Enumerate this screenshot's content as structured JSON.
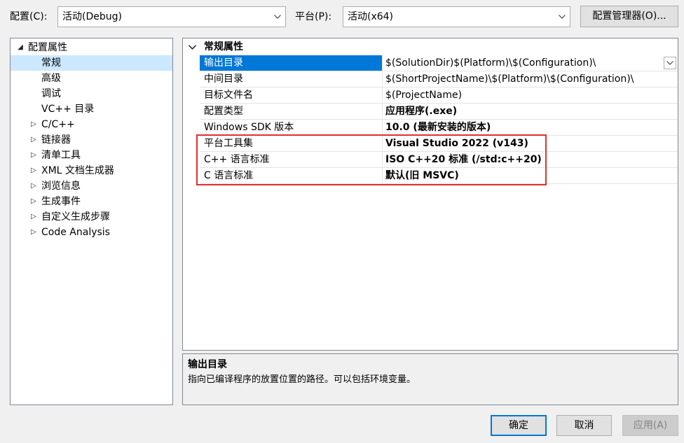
{
  "toolbar": {
    "config_label": "配置(C):",
    "config_value": "活动(Debug)",
    "platform_label": "平台(P):",
    "platform_value": "活动(x64)",
    "config_manager_button": "配置管理器(O)..."
  },
  "tree": {
    "root": "配置属性",
    "items": [
      {
        "label": "常规",
        "selected": true,
        "expandable": false
      },
      {
        "label": "高级",
        "expandable": false
      },
      {
        "label": "调试",
        "expandable": false
      },
      {
        "label": "VC++ 目录",
        "expandable": false
      },
      {
        "label": "C/C++",
        "expandable": true
      },
      {
        "label": "链接器",
        "expandable": true
      },
      {
        "label": "清单工具",
        "expandable": true
      },
      {
        "label": "XML 文档生成器",
        "expandable": true
      },
      {
        "label": "浏览信息",
        "expandable": true
      },
      {
        "label": "生成事件",
        "expandable": true
      },
      {
        "label": "自定义生成步骤",
        "expandable": true
      },
      {
        "label": "Code Analysis",
        "expandable": true
      }
    ]
  },
  "grid": {
    "category": "常规属性",
    "rows": [
      {
        "name": "输出目录",
        "value": "$(SolutionDir)$(Platform)\\$(Configuration)\\",
        "selected": true
      },
      {
        "name": "中间目录",
        "value": "$(ShortProjectName)\\$(Platform)\\$(Configuration)\\"
      },
      {
        "name": "目标文件名",
        "value": "$(ProjectName)"
      },
      {
        "name": "配置类型",
        "value": "应用程序(.exe)",
        "bold": true
      },
      {
        "name": "Windows SDK 版本",
        "value": "10.0 (最新安装的版本)",
        "bold": true
      },
      {
        "name": "平台工具集",
        "value": "Visual Studio 2022 (v143)",
        "bold": true
      },
      {
        "name": "C++ 语言标准",
        "value": "ISO C++20 标准 (/std:c++20)",
        "bold": true
      },
      {
        "name": "C 语言标准",
        "value": "默认(旧 MSVC)",
        "bold": true
      }
    ]
  },
  "description": {
    "title": "输出目录",
    "text": "指向已编译程序的放置位置的路径。可以包括环境变量。"
  },
  "buttons": {
    "ok": "确定",
    "cancel": "取消",
    "apply": "应用(A)"
  },
  "colors": {
    "selection": "#0078d7",
    "highlight_box": "#e0302f",
    "tree_selection": "#cce8ff"
  }
}
